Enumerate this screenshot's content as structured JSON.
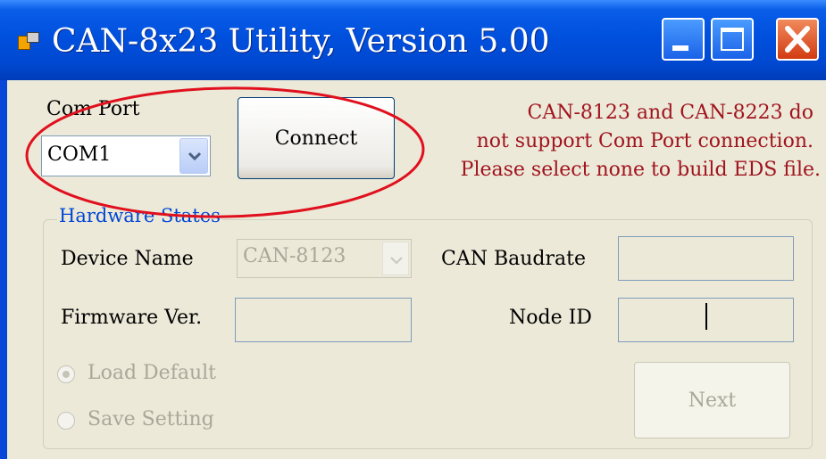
{
  "window": {
    "title": "CAN-8x23 Utility, Version 5.00",
    "icons": {
      "app": "app-icon",
      "minimize": "minimize-icon",
      "maximize": "maximize-icon",
      "close": "close-icon"
    }
  },
  "com_port": {
    "label": "Com Port",
    "selected": "COM1",
    "connect_label": "Connect"
  },
  "notice": {
    "lines": [
      "CAN-8123 and CAN-8223 do",
      "not support Com Port connection.",
      "Please select none to build EDS file."
    ],
    "color": "#a0141e"
  },
  "hardware": {
    "legend": "Hardware States",
    "device_name_label": "Device Name",
    "device_name_value": "CAN-8123",
    "can_baudrate_label": "CAN Baudrate",
    "can_baudrate_value": "",
    "firmware_label": "Firmware Ver.",
    "firmware_value": "",
    "node_id_label": "Node ID",
    "node_id_value": "",
    "load_default_label": "Load Default",
    "save_setting_label": "Save Setting",
    "next_label": "Next"
  },
  "colors": {
    "titlebar": "#0050de",
    "accent": "#0046d5",
    "annotation": "#e0101e"
  }
}
